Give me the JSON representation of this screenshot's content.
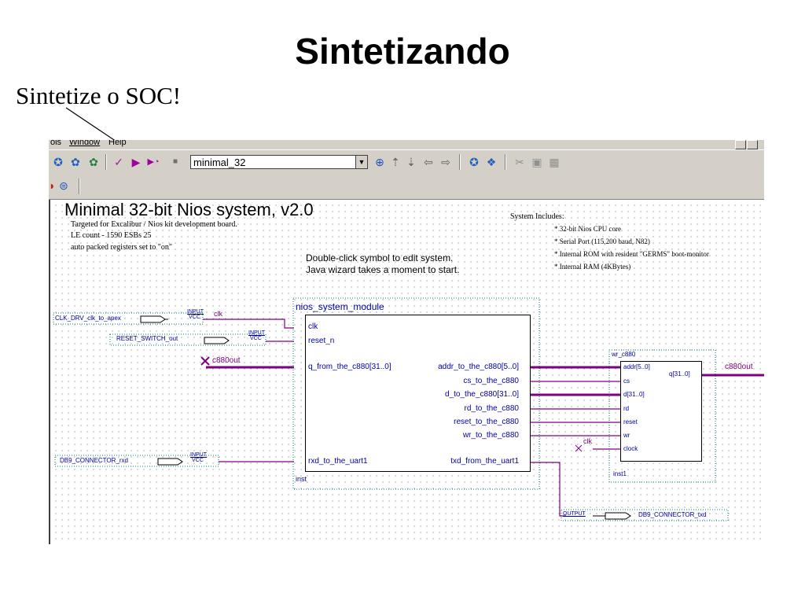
{
  "slide": {
    "title": "Sintetizando",
    "subtitle": "Sintetize o SOC!"
  },
  "menubar": {
    "items": [
      "ols",
      "Window",
      "Help"
    ]
  },
  "toolbar": {
    "project_combo_value": "minimal_32"
  },
  "canvas": {
    "heading": "Minimal 32-bit Nios system, v2.0",
    "notes": [
      "Targeted for Excalibur / Nios kit development board.",
      "LE count - 1590   ESBs 25",
      "auto packed registers set to \"on\""
    ],
    "hint_lines": [
      "Double-click symbol to edit system.",
      "Java wizard takes a moment to start."
    ],
    "system_includes_title": "System Includes:",
    "system_includes": [
      "* 32-bit Nios CPU core",
      "* Serial Port (115,200 baud, N82)",
      "* Internal ROM with resident \"GERMS\" boot-monitor",
      "* Internal RAM (4KBytes)"
    ]
  },
  "inputs": {
    "clk": {
      "name": "CLK_DRV_clk_to_apex",
      "type": "INPUT",
      "vcc": "VCC",
      "net": "clk"
    },
    "reset": {
      "name": "RESET_SWITCH_out",
      "type": "INPUT",
      "vcc": "VCC"
    },
    "rxd": {
      "name": "DB9_CONNECTOR_rxd",
      "type": "INPUT",
      "vcc": "VCC"
    },
    "c880out_net": "c880out"
  },
  "nios_module": {
    "name": "nios_system_module",
    "inst": "inst",
    "left_ports": [
      "clk",
      "reset_n",
      "q_from_the_c880[31..0]",
      "rxd_to_the_uart1"
    ],
    "right_ports": [
      "addr_to_the_c880[5..0]",
      "cs_to_the_c880",
      "d_to_the_c880[31..0]",
      "rd_to_the_c880",
      "reset_to_the_c880",
      "wr_to_the_c880",
      "txd_from_the_uart1"
    ]
  },
  "wr_module": {
    "name": "wr_c880",
    "inst": "inst1",
    "left_ports": [
      "addr[5..0]",
      "cs",
      "d[31..0]",
      "rd",
      "reset",
      "wr",
      "clock"
    ],
    "right_port": "q[31..0]",
    "out_net": "c880out",
    "clk_net": "clk"
  },
  "output": {
    "type": "OUTPUT",
    "name": "DB9_CONNECTOR_txd"
  },
  "colors": {
    "wire": "#800080",
    "bus": "#800080",
    "text_blue": "#0000a0",
    "chrome": "#d4d0c8"
  }
}
